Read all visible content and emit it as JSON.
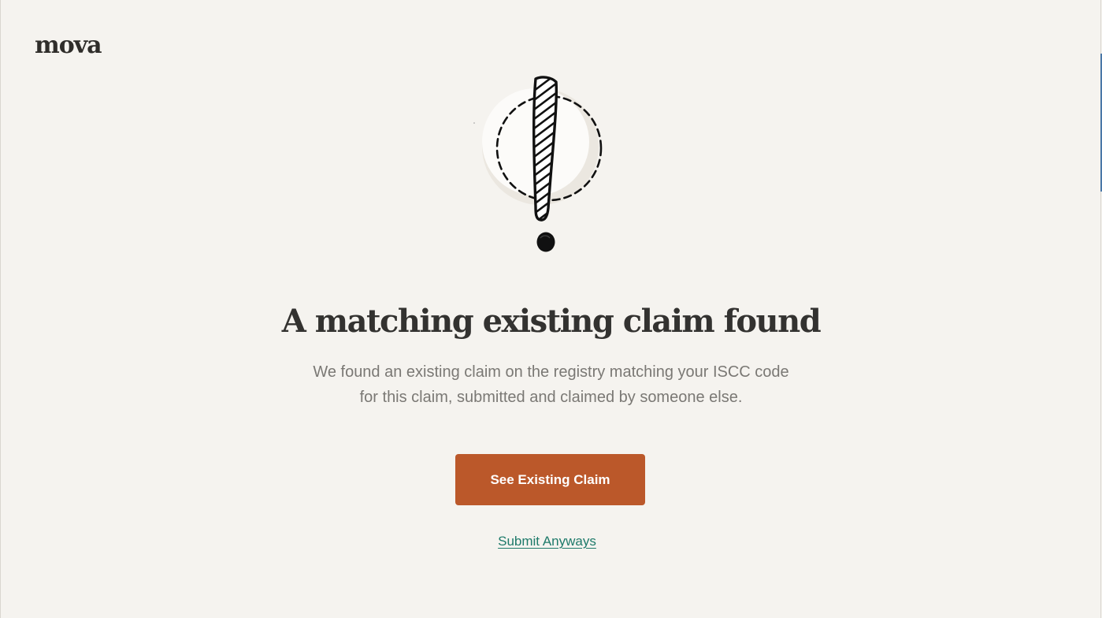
{
  "brand": {
    "logo_text": "mova"
  },
  "illustration": {
    "icon": "exclamation-mark-icon",
    "circle_color": "#fcfbf9",
    "ink_color": "#111111"
  },
  "dialog": {
    "title": "A matching existing claim found",
    "description_line1": "We found an existing claim on the registry matching your ISCC code",
    "description_line2": "for this claim, submitted and claimed by someone else."
  },
  "actions": {
    "primary_label": "See Existing Claim",
    "secondary_label": "Submit Anyways"
  },
  "colors": {
    "background": "#f5f3ef",
    "primary_button": "#bb582a",
    "link": "#1e7a6a",
    "heading": "#333230",
    "body_text": "#7a7874"
  }
}
